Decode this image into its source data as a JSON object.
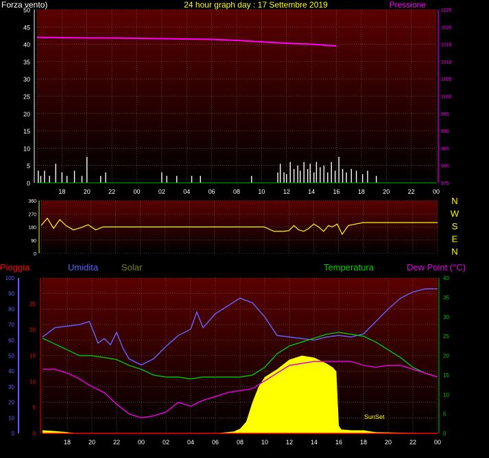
{
  "header": {
    "left_label": "Forza vento)",
    "title": "24 hour graph day : 17 Settembre 2019",
    "right_label": "Pressione"
  },
  "colors": {
    "background": "#000000",
    "plot_gradient_top": "#5a0000",
    "plot_gradient_bottom": "#000000",
    "pressure": "#ff00ff",
    "wind": "#ffffff",
    "direction": "#ffff00",
    "rain": "#ff0000",
    "humidity": "#6060ff",
    "solar": "#ffff00",
    "temperature": "#00c000",
    "dewpoint": "#e000e0",
    "title": "#ffff00",
    "axis_left_top": "#ffffff",
    "compass": "#ffff00"
  },
  "compass": [
    "N",
    "W",
    "S",
    "E",
    "N"
  ],
  "bottom_labels": {
    "rain": "Pioggia",
    "humidity": "Umidita",
    "solar": "Solar",
    "temperature": "Temperatura",
    "dewpoint": "Dew Point (°C)",
    "sunset": "SunSet"
  },
  "time_ticks": [
    "18",
    "20",
    "22",
    "00",
    "02",
    "04",
    "06",
    "08",
    "10",
    "12",
    "14",
    "16",
    "18",
    "20",
    "22",
    "00"
  ],
  "chart_data": [
    {
      "type": "line",
      "title": "24 hour graph day : 17 Settembre 2019",
      "x_unit": "hour (time of day, 24 h window)",
      "x": [
        16,
        18,
        20,
        22,
        24,
        26,
        28,
        30,
        32,
        34,
        36,
        38,
        40
      ],
      "left_axis": {
        "label": "Forza vento)",
        "ylim": [
          0,
          50
        ],
        "ticks": [
          0,
          5,
          10,
          15,
          20,
          25,
          30,
          35,
          40,
          45,
          50
        ]
      },
      "right_axis": {
        "label": "Pressione",
        "ylim": [
          975,
          1025
        ],
        "ticks": [
          975,
          980,
          985,
          990,
          995,
          1000,
          1005,
          1010,
          1015,
          1020,
          1025
        ]
      },
      "series": [
        {
          "name": "Pressione",
          "axis": "right",
          "color": "#ff00ff",
          "x": [
            16,
            18,
            20,
            22,
            24,
            26,
            28,
            30,
            32,
            34,
            36,
            38,
            40
          ],
          "values": [
            1017.0,
            1016.9,
            1016.8,
            1016.8,
            1016.7,
            1016.6,
            1016.5,
            1016.4,
            1016.1,
            1015.7,
            1015.3,
            1015.0,
            1014.5
          ]
        }
      ],
      "gusts_x": [
        16.1,
        16.3,
        16.6,
        17.0,
        17.5,
        18.0,
        18.4,
        19.0,
        19.6,
        20.0,
        21.1,
        21.5,
        26.0,
        26.4,
        27.2,
        28.4,
        29.1,
        33.2,
        35.3,
        35.5,
        35.8,
        36.0,
        36.3,
        36.6,
        36.9,
        37.1,
        37.4,
        37.7,
        37.9,
        38.2,
        38.4,
        38.7,
        39.0,
        39.3,
        39.6,
        39.9,
        40.2,
        40.5,
        40.8,
        41.2,
        41.6,
        42.1,
        42.5,
        43.2
      ],
      "gusts": [
        3.5,
        2.0,
        3.5,
        2.0,
        5.5,
        3.0,
        2.0,
        3.5,
        2.0,
        7.5,
        2.0,
        3.0,
        3.0,
        2.0,
        2.0,
        2.0,
        2.0,
        2.0,
        3.0,
        5.5,
        3.0,
        2.5,
        6.0,
        4.0,
        5.0,
        3.5,
        6.0,
        4.0,
        5.5,
        3.0,
        6.0,
        4.5,
        5.0,
        3.0,
        6.0,
        3.5,
        7.5,
        4.0,
        3.0,
        4.0,
        3.5,
        2.5,
        3.5,
        2.0
      ]
    },
    {
      "type": "line",
      "x_unit": "hour",
      "ylim": [
        0,
        360
      ],
      "ticks": [
        0,
        90,
        180,
        270,
        360
      ],
      "series": [
        {
          "name": "",
          "color": "#ffff00",
          "x": [
            16,
            16.5,
            17,
            17.5,
            18,
            18.6,
            19.2,
            19.8,
            20.4,
            21,
            22,
            24,
            26,
            28,
            30,
            32,
            34,
            34.8,
            35.2,
            35.6,
            36,
            36.4,
            36.8,
            37.2,
            37.6,
            38,
            38.4,
            38.8,
            39.2,
            39.5,
            39.9,
            40.3,
            40.8,
            41.4,
            42,
            44,
            46,
            48
          ],
          "values": [
            190,
            240,
            170,
            230,
            190,
            160,
            175,
            195,
            160,
            180,
            180,
            180,
            180,
            180,
            180,
            180,
            180,
            150,
            150,
            150,
            155,
            190,
            160,
            150,
            170,
            200,
            180,
            150,
            190,
            180,
            200,
            130,
            190,
            200,
            210,
            210,
            210,
            210
          ]
        }
      ]
    },
    {
      "type": "line",
      "x_unit": "hour",
      "axes": [
        {
          "label": "Umidita",
          "ylim": [
            0,
            100
          ],
          "ticks": [
            0,
            10,
            20,
            30,
            40,
            50,
            60,
            70,
            80,
            90,
            100
          ]
        },
        {
          "label": "Pioggia",
          "ylim": [
            0,
            30
          ],
          "ticks": [
            0,
            5,
            10,
            15,
            20,
            25
          ]
        },
        {
          "label": "Temperatura",
          "ylim": [
            0,
            40
          ],
          "ticks": [
            0,
            5,
            10,
            15,
            20,
            25,
            30,
            35,
            40
          ]
        }
      ],
      "series": [
        {
          "name": "Umidita",
          "axis": "Umidita",
          "color": "#6060ff",
          "x": [
            16,
            17,
            18,
            19,
            19.8,
            20.5,
            21,
            21.5,
            22,
            22.5,
            23,
            24,
            25,
            26,
            27,
            28,
            28.5,
            29,
            30,
            31,
            32,
            33,
            34,
            35,
            36,
            37,
            38,
            39,
            40,
            41,
            42,
            43,
            44,
            45,
            46,
            47,
            48
          ],
          "values": [
            62,
            68,
            69,
            70,
            72,
            58,
            61,
            57,
            65,
            55,
            48,
            44,
            48,
            56,
            63,
            67,
            78,
            68,
            77,
            82,
            87,
            84,
            75,
            63,
            62,
            61,
            60,
            62,
            63,
            62,
            64,
            72,
            80,
            87,
            91,
            93,
            93
          ]
        },
        {
          "name": "Temperatura",
          "axis": "Temperatura",
          "color": "#00c000",
          "x": [
            16,
            17,
            18,
            19,
            20,
            21,
            22,
            23,
            24,
            25,
            26,
            27,
            28,
            29,
            30,
            31,
            32,
            33,
            34,
            35,
            36,
            37,
            38,
            39,
            40,
            41,
            42,
            43,
            44,
            45,
            46,
            47,
            48
          ],
          "values": [
            24.5,
            23.0,
            21.5,
            20.0,
            20.0,
            19.5,
            19.0,
            17.5,
            16.5,
            15.0,
            14.5,
            14.5,
            14.0,
            14.5,
            14.5,
            14.5,
            14.5,
            15.0,
            17.0,
            20.5,
            22.5,
            23.5,
            24.5,
            25.5,
            26.0,
            25.5,
            25.0,
            23.5,
            21.5,
            19.5,
            17.0,
            15.5,
            14.5
          ]
        },
        {
          "name": "Dew Point (°C)",
          "axis": "Temperatura",
          "color": "#e000e0",
          "x": [
            16,
            17,
            18,
            19,
            20,
            21,
            22,
            23,
            24,
            25,
            26,
            27,
            28,
            29,
            30,
            31,
            32,
            33,
            34,
            35,
            36,
            37,
            38,
            39,
            40,
            41,
            42,
            43,
            44,
            45,
            46,
            47,
            48
          ],
          "values": [
            16.5,
            16.5,
            15.5,
            14.0,
            12.0,
            10.5,
            7.5,
            5.0,
            4.0,
            4.5,
            5.5,
            8.0,
            7.0,
            8.5,
            9.5,
            10.5,
            11.0,
            11.5,
            13.5,
            15.5,
            17.5,
            18.0,
            18.5,
            18.5,
            18.5,
            18.5,
            17.5,
            17.0,
            17.5,
            17.5,
            16.5,
            15.5,
            14.5
          ]
        },
        {
          "name": "Solar",
          "axis": "Temperatura",
          "color": "#ffff00",
          "x": [
            16,
            17,
            18,
            18.7,
            19,
            25,
            30,
            31.5,
            32,
            32.5,
            33,
            33.5,
            34,
            35,
            36,
            37,
            38,
            39,
            39.5,
            39.8,
            40,
            40.2,
            41,
            42,
            42.6,
            43,
            48
          ],
          "values": [
            0.8,
            0.6,
            0.3,
            0.05,
            0,
            0,
            0,
            0.5,
            1.2,
            3.0,
            8.0,
            12.0,
            14.5,
            16.5,
            19.0,
            20.0,
            19.5,
            18.0,
            17.0,
            16.0,
            2.0,
            1.0,
            0.8,
            0.8,
            0.5,
            0.3,
            0
          ]
        },
        {
          "name": "Pioggia",
          "axis": "Pioggia",
          "color": "#ff0000",
          "x": [
            16,
            48
          ],
          "values": [
            0,
            0
          ]
        }
      ]
    }
  ]
}
